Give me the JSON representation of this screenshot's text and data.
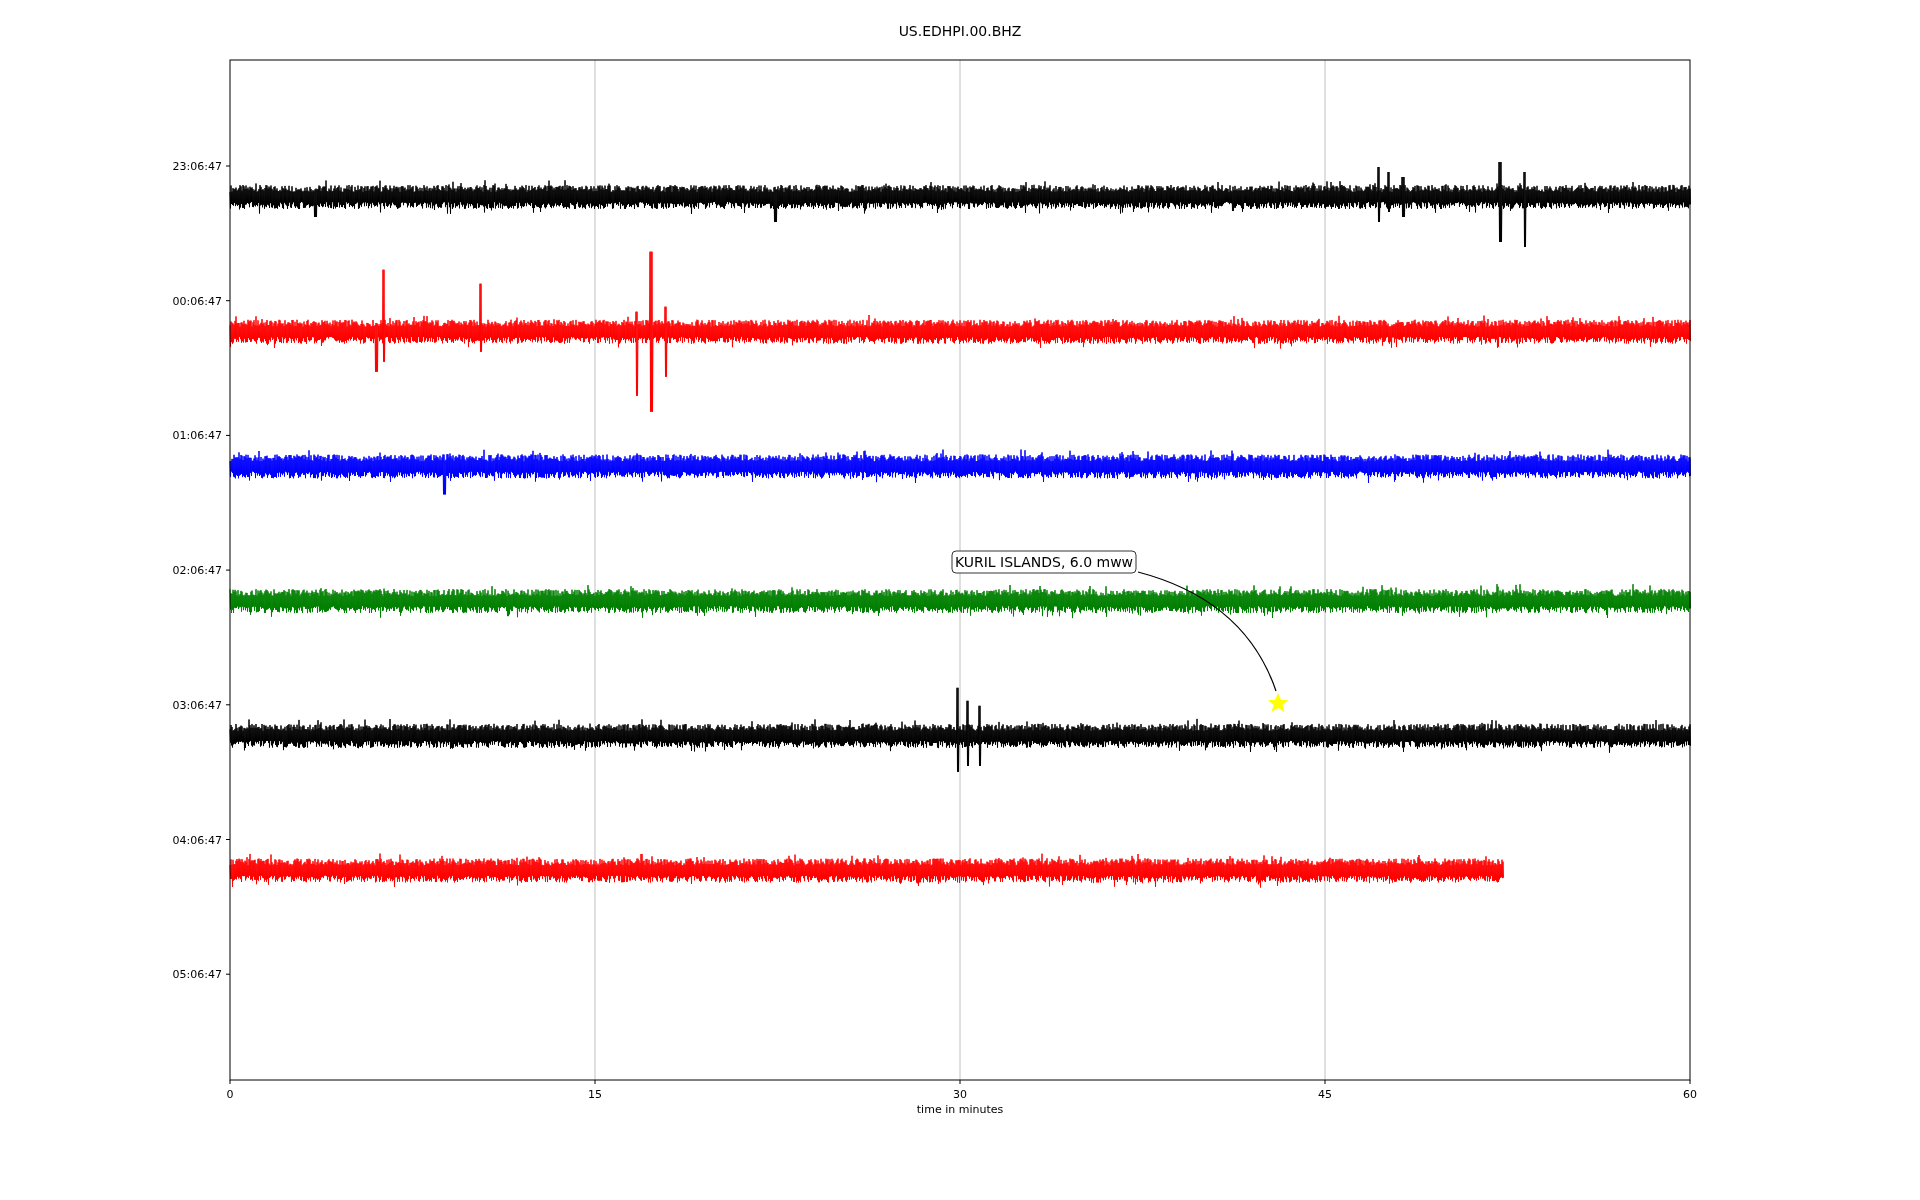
{
  "figure": {
    "title": "US.EDHPI.00.BHZ"
  },
  "plot": {
    "xlabel": "time in minutes",
    "xticks": [
      "0",
      "15",
      "30",
      "45",
      "60"
    ],
    "yticks": [
      "23:06:47",
      "00:06:47",
      "01:06:47",
      "02:06:47",
      "03:06:47",
      "04:06:47",
      "05:06:47"
    ],
    "traces": [
      {
        "color": "#000000",
        "level": 1
      },
      {
        "color": "#ff0000",
        "level": 1
      },
      {
        "color": "#0000ff",
        "level": 1
      },
      {
        "color": "#008000",
        "level": 1
      },
      {
        "color": "#000000",
        "level": 1
      },
      {
        "color": "#ff0000",
        "level": 0.872
      }
    ],
    "annotation": {
      "text": "KURIL ISLANDS, 6.0 mww"
    }
  }
}
